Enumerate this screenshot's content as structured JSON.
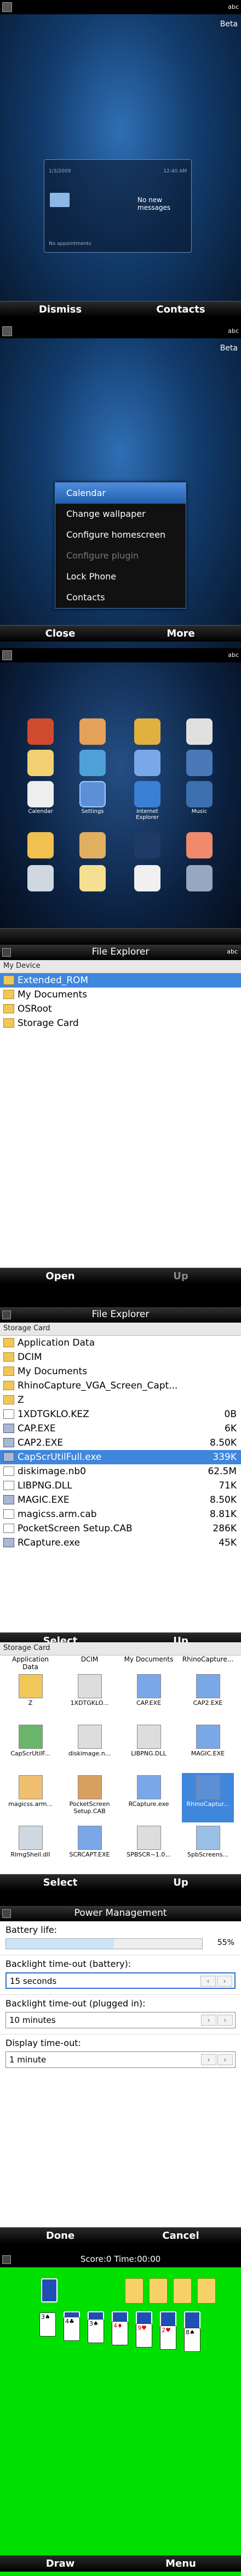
{
  "s1": {
    "status": {
      "right": "abc"
    },
    "beta": "Beta",
    "card": {
      "date_left": "1/3/2009",
      "time_right": "12:40 AM",
      "no_messages": "No new messages",
      "no_appointments": "No appointments"
    },
    "soft": {
      "left": "Dismiss",
      "right": "Contacts"
    }
  },
  "s2": {
    "status": {
      "right": "abc"
    },
    "beta": "Beta",
    "menu": [
      {
        "label": "Calendar",
        "state": "selected"
      },
      {
        "label": "Change wallpaper",
        "state": "normal"
      },
      {
        "label": "Configure homescreen",
        "state": "normal"
      },
      {
        "label": "Configure plugin",
        "state": "disabled"
      },
      {
        "label": "Lock Phone",
        "state": "normal"
      },
      {
        "label": "Contacts",
        "state": "normal"
      }
    ],
    "soft": {
      "left": "Close",
      "right": "More"
    }
  },
  "s3": {
    "status": {
      "right": "abc"
    },
    "labels": {
      "calendar": "Calendar",
      "settings": "Settings",
      "internet": "Internet Explorer",
      "music": "Music"
    },
    "soft": {
      "left": "",
      "right": ""
    }
  },
  "s4": {
    "title": "File Explorer",
    "header": "My Device",
    "rows": [
      {
        "name": "Extended_ROM",
        "selected": true
      },
      {
        "name": "My Documents",
        "selected": false
      },
      {
        "name": "OSRoot",
        "selected": false
      },
      {
        "name": "Storage Card",
        "selected": false
      }
    ],
    "soft": {
      "left": "Open",
      "right": "Up"
    }
  },
  "s5": {
    "title": "File Explorer",
    "header": "Storage Card",
    "rows": [
      {
        "name": "Application Data",
        "size": "",
        "type": "folder"
      },
      {
        "name": "DCIM",
        "size": "",
        "type": "folder"
      },
      {
        "name": "My Documents",
        "size": "",
        "type": "folder"
      },
      {
        "name": "RhinoCapture_VGA_Screen_Capt...",
        "size": "",
        "type": "folder"
      },
      {
        "name": "Z",
        "size": "",
        "type": "folder"
      },
      {
        "name": "1XDTGKLO.KEZ",
        "size": "0B",
        "type": "file"
      },
      {
        "name": "CAP.EXE",
        "size": "6K",
        "type": "exe"
      },
      {
        "name": "CAP2.EXE",
        "size": "8.50K",
        "type": "exe"
      },
      {
        "name": "CapScrUtilFull.exe",
        "size": "339K",
        "type": "exe",
        "selected": true
      },
      {
        "name": "diskimage.nb0",
        "size": "62.5M",
        "type": "file"
      },
      {
        "name": "LIBPNG.DLL",
        "size": "71K",
        "type": "file"
      },
      {
        "name": "MAGIC.EXE",
        "size": "8.50K",
        "type": "exe"
      },
      {
        "name": "magicss.arm.cab",
        "size": "8.81K",
        "type": "file"
      },
      {
        "name": "PocketScreen Setup.CAB",
        "size": "286K",
        "type": "file"
      },
      {
        "name": "RCapture.exe",
        "size": "45K",
        "type": "exe"
      }
    ],
    "soft": {
      "left": "Select",
      "right": "Up"
    }
  },
  "s6": {
    "header": "Storage Card",
    "top_labels": [
      "Application Data",
      "DCIM",
      "My Documents",
      "RhinoCapture..."
    ],
    "items": [
      {
        "name": "Z"
      },
      {
        "name": "1XDTGKLO..."
      },
      {
        "name": "CAP.EXE"
      },
      {
        "name": "CAP2.EXE"
      },
      {
        "name": "CapScrUtilF..."
      },
      {
        "name": "diskimage.n..."
      },
      {
        "name": "LIBPNG.DLL"
      },
      {
        "name": "MAGIC.EXE"
      },
      {
        "name": "magicss.arm..."
      },
      {
        "name": "PocketScreen Setup.CAB"
      },
      {
        "name": "RCapture.exe"
      },
      {
        "name": "RhinoCaptur..."
      },
      {
        "name": "RImgShell.dll"
      },
      {
        "name": "SCRCAPT.EXE"
      },
      {
        "name": "SPBSCR~1.0..."
      },
      {
        "name": "SpbScreens..."
      }
    ],
    "soft": {
      "left": "Select",
      "right": "Up"
    }
  },
  "s7": {
    "title": "Power Management",
    "battery_label": "Battery life:",
    "battery_pct": "55%",
    "battery_fraction": 0.55,
    "backlight_batt_label": "Backlight time-out (battery):",
    "backlight_batt_value": "15 seconds",
    "backlight_plug_label": "Backlight time-out (plugged in):",
    "backlight_plug_value": "10 minutes",
    "display_label": "Display time-out:",
    "display_value": "1 minute",
    "soft": {
      "left": "Done",
      "right": "Cancel"
    }
  },
  "s8": {
    "score": "Score:0 Time:00:00",
    "soft": {
      "left": "Draw",
      "right": "Menu"
    }
  }
}
